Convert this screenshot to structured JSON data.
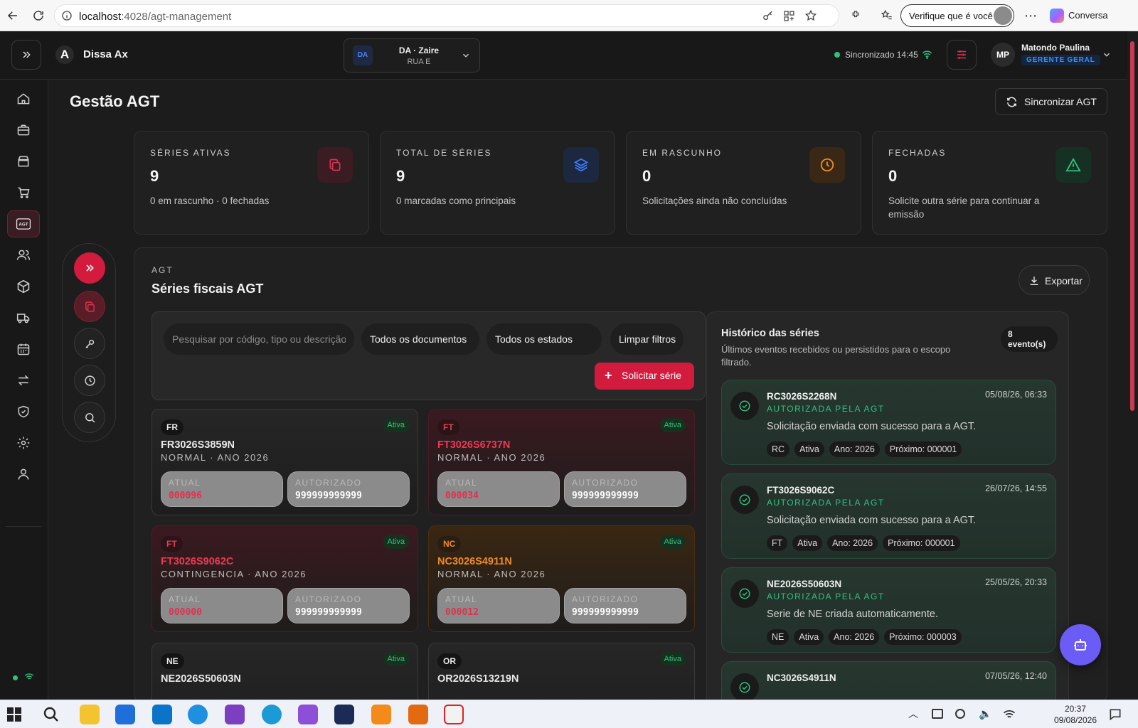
{
  "browser": {
    "url_host": "localhost",
    "url_path": ":4028/agt-management",
    "verify_label": "Verifique que é você",
    "conversa_label": "Conversa"
  },
  "topbar": {
    "brand": "Dissa Ax",
    "logo_letter": "A",
    "store": {
      "badge": "DA",
      "name": "DA · Zaire",
      "sub": "RUA E"
    },
    "sync_status": "Sincronizado 14:45",
    "user": {
      "initials": "MP",
      "name": "Matondo Paulina",
      "role": "GERENTE GERAL"
    }
  },
  "sidebar": {
    "items": [
      "home-icon",
      "briefcase-icon",
      "store-icon",
      "cart-icon",
      "agt-icon",
      "users-icon",
      "box-icon",
      "truck-icon",
      "calendar-icon",
      "transfer-icon",
      "shield-icon",
      "gear-icon",
      "user-icon"
    ],
    "active": "agt-icon",
    "agt_label": "AGT",
    "avatar": "MP"
  },
  "page": {
    "title": "Gestão AGT",
    "sync_button": "Sincronizar AGT"
  },
  "stats": [
    {
      "label": "SÉRIES ATIVAS",
      "value": "9",
      "desc": "0 em rascunho · 0 fechadas",
      "icon": "copy-icon",
      "color": "#e0314f",
      "bg": "#3a1c22"
    },
    {
      "label": "TOTAL DE SÉRIES",
      "value": "9",
      "desc": "0 marcadas como principais",
      "icon": "layers-icon",
      "color": "#3d7bff",
      "bg": "#1c2740"
    },
    {
      "label": "EM RASCUNHO",
      "value": "0",
      "desc": "Solicitações ainda não concluídas",
      "icon": "clock-icon",
      "color": "#f08a24",
      "bg": "#3a2816"
    },
    {
      "label": "FECHADAS",
      "value": "0",
      "desc": "Solicite outra série para continuar a emissão",
      "icon": "alert-icon",
      "color": "#2ec27e",
      "bg": "#173024"
    }
  ],
  "series_panel": {
    "eyebrow": "AGT",
    "title": "Séries fiscais AGT",
    "export_label": "Exportar",
    "search_placeholder": "Pesquisar por código, tipo ou descrição",
    "doc_filter": "Todos os documentos",
    "state_filter": "Todos os estados",
    "clear_label": "Limpar filtros",
    "request_label": "Solicitar série",
    "box_labels": {
      "current": "ATUAL",
      "authorized": "AUTORIZADO"
    }
  },
  "series": [
    {
      "type": "FR",
      "status": "Ativa",
      "code": "FR3026S3859N",
      "meta": "NORMAL · ANO 2026",
      "current": "000096",
      "authorized": "999999999999",
      "theme": "fr",
      "accent": "#f0f0f0"
    },
    {
      "type": "FT",
      "status": "Ativa",
      "code": "FT3026S6737N",
      "meta": "NORMAL · ANO 2026",
      "current": "000034",
      "authorized": "999999999999",
      "theme": "red",
      "accent": "#ec3a52"
    },
    {
      "type": "FT",
      "status": "Ativa",
      "code": "FT3026S9062C",
      "meta": "CONTINGENCIA · ANO 2026",
      "current": "000000",
      "authorized": "999999999999",
      "theme": "red",
      "accent": "#ec3a52"
    },
    {
      "type": "NC",
      "status": "Ativa",
      "code": "NC3026S4911N",
      "meta": "NORMAL · ANO 2026",
      "current": "000012",
      "authorized": "999999999999",
      "theme": "ora",
      "accent": "#f08a24"
    },
    {
      "type": "NE",
      "status": "Ativa",
      "code": "NE2026S50603N",
      "meta": "",
      "current": "",
      "authorized": "",
      "theme": "fr",
      "accent": "#f0f0f0"
    },
    {
      "type": "OR",
      "status": "Ativa",
      "code": "OR2026S13219N",
      "meta": "",
      "current": "",
      "authorized": "",
      "theme": "fr",
      "accent": "#f0f0f0"
    }
  ],
  "history": {
    "title": "Histórico das séries",
    "subtitle": "Últimos eventos recebidos ou persistidos para o escopo filtrado.",
    "count_num": "8",
    "count_word": "evento(s)",
    "items": [
      {
        "code": "RC3026S2268N",
        "status": "AUTORIZADA PELA AGT",
        "date": "05/08/26, 06:33",
        "message": "Solicitação enviada com sucesso para a AGT.",
        "tags": [
          "RC",
          "Ativa",
          "Ano: 2026",
          "Próximo: 000001"
        ]
      },
      {
        "code": "FT3026S9062C",
        "status": "AUTORIZADA PELA AGT",
        "date": "26/07/26, 14:55",
        "message": "Solicitação enviada com sucesso para a AGT.",
        "tags": [
          "FT",
          "Ativa",
          "Ano: 2026",
          "Próximo: 000001"
        ]
      },
      {
        "code": "NE2026S50603N",
        "status": "AUTORIZADA PELA AGT",
        "date": "25/05/26, 20:33",
        "message": "Serie de NE criada automaticamente.",
        "tags": [
          "NE",
          "Ativa",
          "Ano: 2026",
          "Próximo: 000003"
        ]
      },
      {
        "code": "NC3026S4911N",
        "status": "",
        "date": "07/05/26, 12:40",
        "message": "",
        "tags": []
      }
    ]
  },
  "taskbar": {
    "time": "20:37",
    "date": "09/08/2026"
  }
}
